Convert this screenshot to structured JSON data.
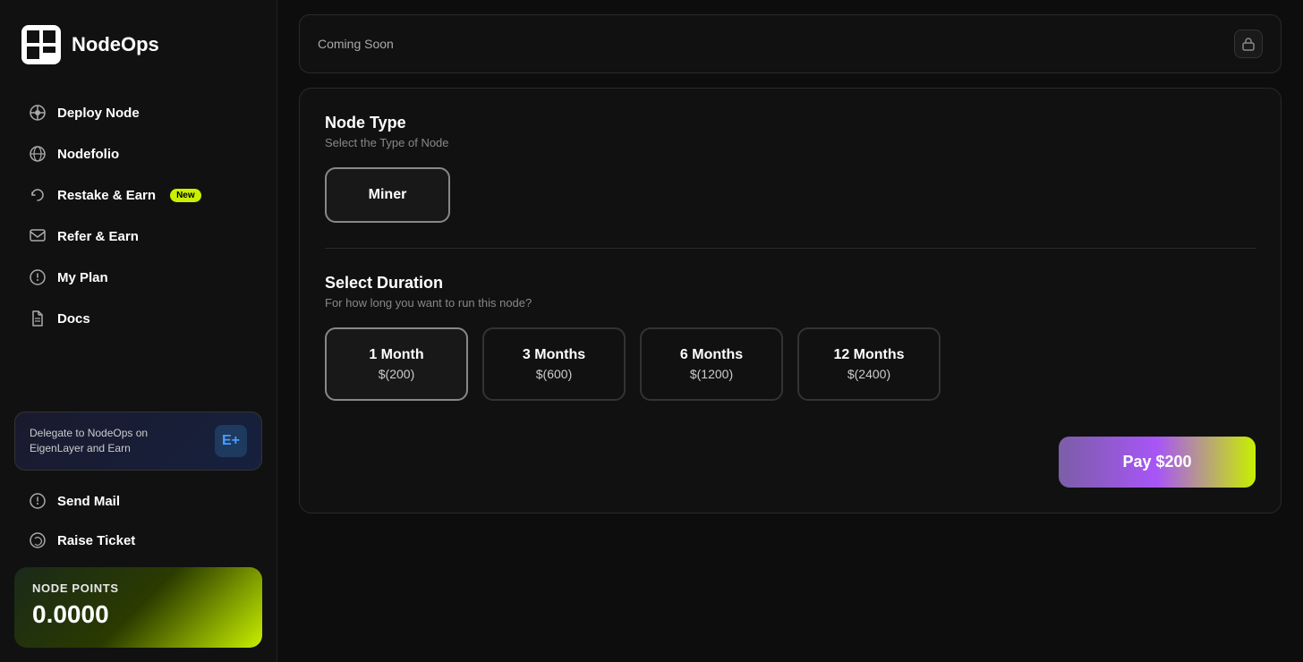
{
  "app": {
    "title": "NodeOps"
  },
  "sidebar": {
    "logo_text": "NodeOps",
    "nav_items": [
      {
        "id": "deploy-node",
        "label": "Deploy Node",
        "icon": "node-icon"
      },
      {
        "id": "nodefolio",
        "label": "Nodefolio",
        "icon": "portfolio-icon"
      },
      {
        "id": "restake-earn",
        "label": "Restake & Earn",
        "icon": "restake-icon",
        "badge": "New"
      },
      {
        "id": "refer-earn",
        "label": "Refer & Earn",
        "icon": "refer-icon"
      },
      {
        "id": "my-plan",
        "label": "My Plan",
        "icon": "plan-icon"
      },
      {
        "id": "docs",
        "label": "Docs",
        "icon": "docs-icon"
      }
    ],
    "delegate_banner": {
      "text": "Delegate to NodeOps on EigenLayer and Earn",
      "logo_text": "E+"
    },
    "bottom_nav": [
      {
        "id": "send-mail",
        "label": "Send Mail",
        "icon": "mail-icon"
      },
      {
        "id": "raise-ticket",
        "label": "Raise Ticket",
        "icon": "ticket-icon"
      }
    ],
    "node_points": {
      "label": "NODE Points",
      "value": "0.0000"
    }
  },
  "main": {
    "coming_soon_text": "Coming Soon",
    "node_type_section": {
      "title": "Node Type",
      "subtitle": "Select the Type of Node",
      "options": [
        {
          "id": "miner",
          "label": "Miner",
          "selected": true
        }
      ]
    },
    "duration_section": {
      "title": "Select Duration",
      "subtitle": "For how long you want to run this node?",
      "options": [
        {
          "id": "1month",
          "months_label": "1 Month",
          "price_label": "$(200)",
          "selected": true
        },
        {
          "id": "3months",
          "months_label": "3 Months",
          "price_label": "$(600)",
          "selected": false
        },
        {
          "id": "6months",
          "months_label": "6 Months",
          "price_label": "$(1200)",
          "selected": false
        },
        {
          "id": "12months",
          "months_label": "12 Months",
          "price_label": "$(2400)",
          "selected": false
        }
      ]
    },
    "pay_button_label": "Pay $200"
  }
}
